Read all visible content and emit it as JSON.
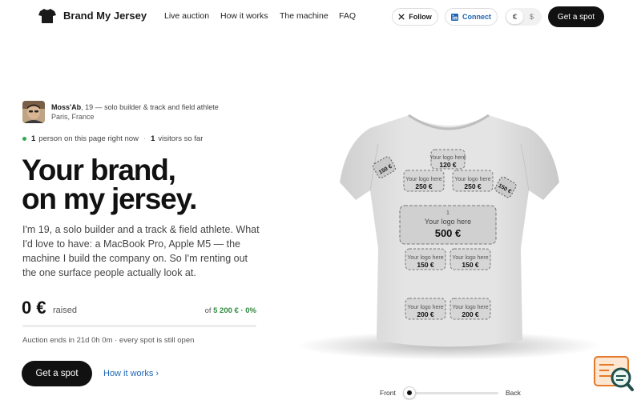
{
  "header": {
    "brand": "Brand My Jersey",
    "nav": [
      "Live auction",
      "How it works",
      "The machine",
      "FAQ"
    ],
    "follow_label": "Follow",
    "connect_label": "Connect",
    "currencies": [
      "€",
      "$"
    ],
    "active_currency": "€",
    "cta_label": "Get a spot"
  },
  "profile": {
    "name": "Moss'Ab",
    "bio": ", 19 — solo builder & track and field athlete",
    "location": "Paris, France",
    "viewers_count": "1",
    "viewers_label": "person on this page right now",
    "visitors_count": "1",
    "visitors_label": "visitors so far"
  },
  "hero": {
    "headline_line1": "Your brand,",
    "headline_line2": "on my jersey.",
    "description": "I'm 19, a solo builder and a track & field athlete. What I'd love to have: a MacBook Pro, Apple M5 — the machine I build the company on. So I'm renting out the one surface people actually look at."
  },
  "funding": {
    "raised_amount": "0 €",
    "raised_label": "raised",
    "goal_prefix": "of ",
    "goal_amount": "5 200 € · 0%",
    "progress_percent": 0,
    "auction_text": "Auction ends in 21d 0h 0m · every spot is still open"
  },
  "actions": {
    "cta_label": "Get a spot",
    "how_label": "How it works ›"
  },
  "jersey": {
    "slot_placeholder": "Your logo here",
    "slots": [
      {
        "id": "1",
        "price": "500 €",
        "featured": true
      },
      {
        "id": "",
        "price": "120 €"
      },
      {
        "id": "",
        "price": "250 €"
      },
      {
        "id": "",
        "price": "250 €"
      },
      {
        "id": "",
        "price": "150 €"
      },
      {
        "id": "",
        "price": "150 €"
      },
      {
        "id": "",
        "price": "200 €"
      },
      {
        "id": "",
        "price": "200 €"
      },
      {
        "id": "",
        "price": "150 €"
      },
      {
        "id": "",
        "price": "150 €"
      }
    ],
    "view_front": "Front",
    "view_back": "Back",
    "view_position": 0
  },
  "colors": {
    "accent_green": "#2fa84f",
    "link_blue": "#1e66b3",
    "primary_dark": "#111111"
  }
}
